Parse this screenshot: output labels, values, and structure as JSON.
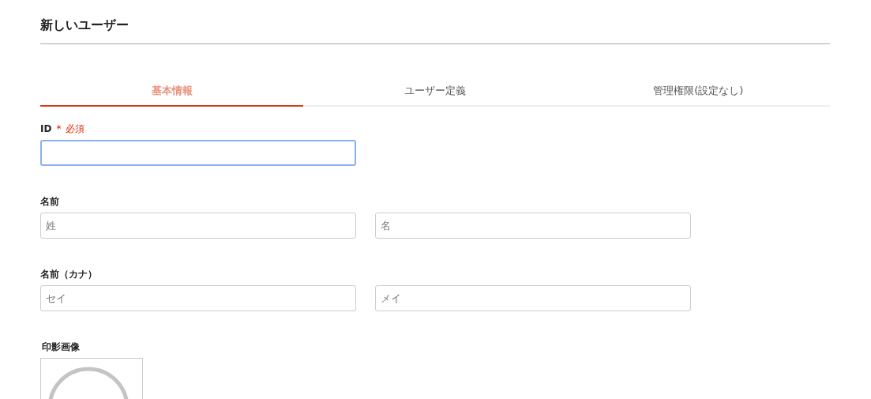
{
  "title": "新しいユーザー",
  "tabs": [
    {
      "label": "基本情報",
      "selected": true
    },
    {
      "label": "ユーザー定義",
      "selected": false
    },
    {
      "label": "管理権限(設定なし)",
      "selected": false
    }
  ],
  "fields": [
    {
      "label": "ID",
      "required_mark": "*",
      "required_text": "必須",
      "inputs": [
        {
          "focused": true
        }
      ]
    },
    {
      "label": "名前",
      "inputs": [
        {
          "placeholder": "姓",
          "focused": false
        },
        {
          "placeholder": "名",
          "focused": false
        }
      ]
    },
    {
      "label": "名前（カナ）",
      "inputs": [
        {
          "placeholder": "セイ",
          "focused": false
        },
        {
          "placeholder": "メイ",
          "focused": false
        }
      ]
    }
  ],
  "stamp": {
    "label": "印影画像"
  }
}
